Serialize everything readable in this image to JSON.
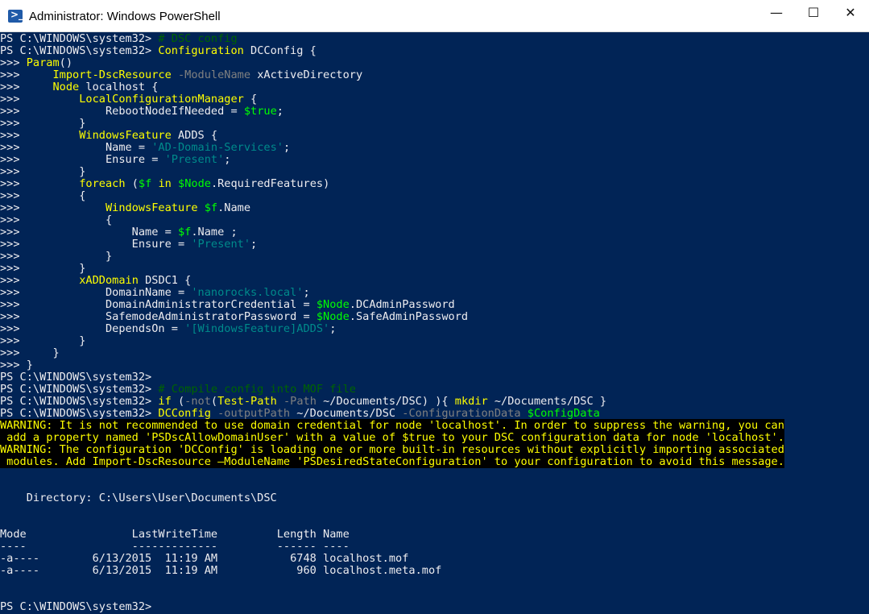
{
  "window": {
    "title": "Administrator: Windows PowerShell",
    "icon": "powershell-icon",
    "controls": {
      "minimize": "—",
      "maximize": "☐",
      "close": "✕"
    }
  },
  "colors": {
    "background": "#012456",
    "text": "#eeedf0",
    "keyword": "#ffff00",
    "comment": "#006400",
    "variable": "#00ff00",
    "parameter": "#808080",
    "string": "#008b8b",
    "warning_fg": "#ffff00",
    "warning_bg": "#000000"
  },
  "console": {
    "lines": [
      [
        [
          "PS C:\\WINDOWS\\system32> ",
          ""
        ],
        [
          "# DSC config",
          "cmt"
        ]
      ],
      [
        [
          "PS C:\\WINDOWS\\system32> ",
          ""
        ],
        [
          "Configuration",
          "kw"
        ],
        [
          " DCConfig {",
          ""
        ]
      ],
      [
        [
          ">>> ",
          ""
        ],
        [
          "Param",
          "kw"
        ],
        [
          "()",
          ""
        ]
      ],
      [
        [
          ">>>     ",
          ""
        ],
        [
          "Import-DscResource",
          "kw"
        ],
        [
          " ",
          ""
        ],
        [
          "-ModuleName",
          "param"
        ],
        [
          " xActiveDirectory",
          ""
        ]
      ],
      [
        [
          ">>>     ",
          ""
        ],
        [
          "Node",
          "kw"
        ],
        [
          " localhost {",
          ""
        ]
      ],
      [
        [
          ">>>         ",
          ""
        ],
        [
          "LocalConfigurationManager",
          "kw"
        ],
        [
          " {",
          ""
        ]
      ],
      [
        [
          ">>>             RebootNodeIfNeeded = ",
          ""
        ],
        [
          "$true",
          "var"
        ],
        [
          ";",
          ""
        ]
      ],
      [
        [
          ">>>         }",
          ""
        ]
      ],
      [
        [
          ">>>         ",
          ""
        ],
        [
          "WindowsFeature",
          "kw"
        ],
        [
          " ADDS {",
          ""
        ]
      ],
      [
        [
          ">>>             Name = ",
          ""
        ],
        [
          "'AD-Domain-Services'",
          "str"
        ],
        [
          ";",
          ""
        ]
      ],
      [
        [
          ">>>             Ensure = ",
          ""
        ],
        [
          "'Present'",
          "str"
        ],
        [
          ";",
          ""
        ]
      ],
      [
        [
          ">>>         }",
          ""
        ]
      ],
      [
        [
          ">>>         ",
          ""
        ],
        [
          "foreach",
          "kw"
        ],
        [
          " (",
          ""
        ],
        [
          "$f",
          "var"
        ],
        [
          " ",
          ""
        ],
        [
          "in",
          "kw"
        ],
        [
          " ",
          ""
        ],
        [
          "$Node",
          "var"
        ],
        [
          ".RequiredFeatures)",
          ""
        ]
      ],
      [
        [
          ">>>         {",
          ""
        ]
      ],
      [
        [
          ">>>             ",
          ""
        ],
        [
          "WindowsFeature",
          "kw"
        ],
        [
          " ",
          ""
        ],
        [
          "$f",
          "var"
        ],
        [
          ".Name",
          ""
        ]
      ],
      [
        [
          ">>>             {",
          ""
        ]
      ],
      [
        [
          ">>>                 Name = ",
          ""
        ],
        [
          "$f",
          "var"
        ],
        [
          ".Name ;",
          ""
        ]
      ],
      [
        [
          ">>>                 Ensure = ",
          ""
        ],
        [
          "'Present'",
          "str"
        ],
        [
          ";",
          ""
        ]
      ],
      [
        [
          ">>>             }",
          ""
        ]
      ],
      [
        [
          ">>>         }",
          ""
        ]
      ],
      [
        [
          ">>>         ",
          ""
        ],
        [
          "xADDomain",
          "kw"
        ],
        [
          " DSDC1 {",
          ""
        ]
      ],
      [
        [
          ">>>             DomainName = ",
          ""
        ],
        [
          "'nanorocks.local'",
          "str"
        ],
        [
          ";",
          ""
        ]
      ],
      [
        [
          ">>>             DomainAdministratorCredential = ",
          ""
        ],
        [
          "$Node",
          "var"
        ],
        [
          ".DCAdminPassword",
          ""
        ]
      ],
      [
        [
          ">>>             SafemodeAdministratorPassword = ",
          ""
        ],
        [
          "$Node",
          "var"
        ],
        [
          ".SafeAdminPassword",
          ""
        ]
      ],
      [
        [
          ">>>             DependsOn = ",
          ""
        ],
        [
          "'[WindowsFeature]ADDS'",
          "str"
        ],
        [
          ";",
          ""
        ]
      ],
      [
        [
          ">>>         }",
          ""
        ]
      ],
      [
        [
          ">>>     }",
          ""
        ]
      ],
      [
        [
          ">>> }",
          ""
        ]
      ],
      [
        [
          "PS C:\\WINDOWS\\system32>",
          ""
        ]
      ],
      [
        [
          "PS C:\\WINDOWS\\system32> ",
          ""
        ],
        [
          "# Compile config into MOF file",
          "cmt"
        ]
      ],
      [
        [
          "PS C:\\WINDOWS\\system32> ",
          ""
        ],
        [
          "if",
          "kw"
        ],
        [
          " (",
          ""
        ],
        [
          "-not",
          "param"
        ],
        [
          "(",
          ""
        ],
        [
          "Test-Path",
          "kw"
        ],
        [
          " ",
          ""
        ],
        [
          "-Path",
          "param"
        ],
        [
          " ~/Documents/DSC) ){ ",
          ""
        ],
        [
          "mkdir",
          "kw"
        ],
        [
          " ~/Documents/DSC }",
          ""
        ]
      ],
      [
        [
          "PS C:\\WINDOWS\\system32> ",
          ""
        ],
        [
          "DCConfig",
          "kw"
        ],
        [
          " ",
          ""
        ],
        [
          "-outputPath",
          "param"
        ],
        [
          " ~/Documents/DSC ",
          ""
        ],
        [
          "-ConfigurationData",
          "param"
        ],
        [
          " ",
          ""
        ],
        [
          "$ConfigData",
          "var"
        ]
      ],
      [
        [
          "WARNING: It is not recommended to use domain credential for node 'localhost'. In order to suppress the warning, you can",
          "warn"
        ]
      ],
      [
        [
          " add a property named 'PSDscAllowDomainUser' with a value of $true to your DSC configuration data for node 'localhost'.",
          "warn"
        ]
      ],
      [
        [
          "WARNING: The configuration 'DCConfig' is loading one or more built-in resources without explicitly importing associated",
          "warn"
        ]
      ],
      [
        [
          " modules. Add Import-DscResource –ModuleName 'PSDesiredStateConfiguration' to your configuration to avoid this message.",
          "warn"
        ]
      ],
      [],
      [],
      [
        [
          "    Directory: C:\\Users\\User\\Documents\\DSC",
          ""
        ]
      ],
      [],
      [],
      [
        [
          "Mode                LastWriteTime         Length Name",
          ""
        ]
      ],
      [
        [
          "----                -------------         ------ ----",
          ""
        ]
      ],
      [
        [
          "-a----        6/13/2015  11:19 AM           6748 localhost.mof",
          ""
        ]
      ],
      [
        [
          "-a----        6/13/2015  11:19 AM            960 localhost.meta.mof",
          ""
        ]
      ],
      [],
      [],
      [
        [
          "PS C:\\WINDOWS\\system32>",
          ""
        ]
      ]
    ]
  }
}
